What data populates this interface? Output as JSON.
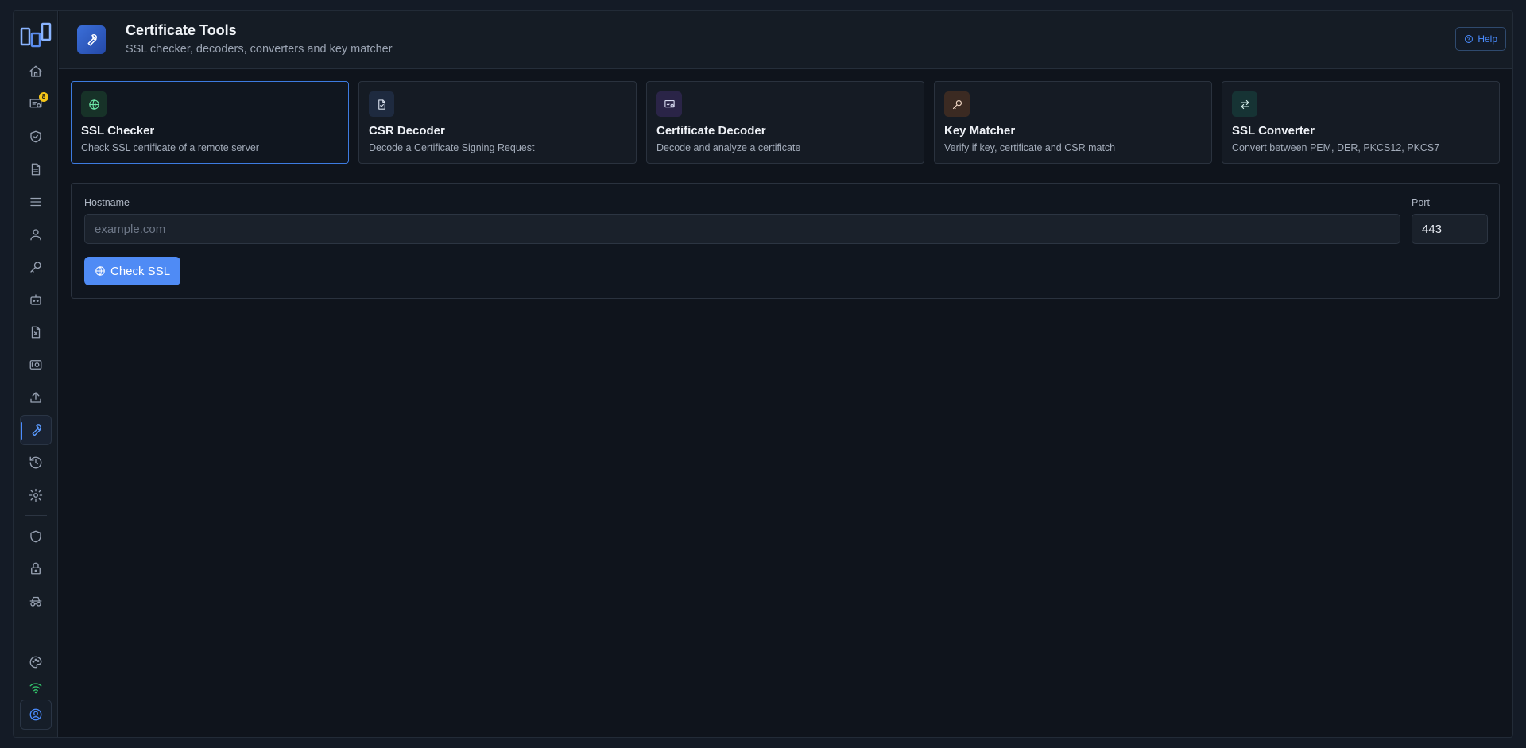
{
  "header": {
    "title": "Certificate Tools",
    "subtitle": "SSL checker, decoders, converters and key matcher",
    "help_label": "Help",
    "icon": "wrench-icon"
  },
  "sidebar": {
    "badge_count": "8",
    "accent_color": "#4a8cff",
    "items": [
      {
        "name": "home",
        "icon": "home-icon"
      },
      {
        "name": "certificates",
        "icon": "certificate-icon",
        "badge": "8"
      },
      {
        "name": "shield-check",
        "icon": "shield-check-icon"
      },
      {
        "name": "documents",
        "icon": "document-icon"
      },
      {
        "name": "list",
        "icon": "list-icon"
      },
      {
        "name": "users",
        "icon": "user-icon"
      },
      {
        "name": "keys",
        "icon": "key-icon"
      },
      {
        "name": "bots",
        "icon": "bot-icon"
      },
      {
        "name": "file-code",
        "icon": "file-x-icon"
      },
      {
        "name": "vault",
        "icon": "vault-icon"
      },
      {
        "name": "upload",
        "icon": "upload-icon"
      },
      {
        "name": "tools",
        "icon": "wrench-icon",
        "active": true
      },
      {
        "name": "history",
        "icon": "history-icon"
      },
      {
        "name": "settings",
        "icon": "gear-icon"
      },
      {
        "name": "shield",
        "icon": "shield-icon"
      },
      {
        "name": "lock",
        "icon": "lock-icon"
      },
      {
        "name": "incognito",
        "icon": "incognito-icon"
      },
      {
        "name": "theme",
        "icon": "palette-icon"
      },
      {
        "name": "connection",
        "icon": "wifi-icon"
      },
      {
        "name": "profile",
        "icon": "user-circle-icon"
      }
    ]
  },
  "tools": [
    {
      "title": "SSL Checker",
      "description": "Check SSL certificate of a remote server",
      "icon": "globe-icon",
      "active": true,
      "icon_bg": "#173228",
      "icon_color": "#6ee7a8"
    },
    {
      "title": "CSR Decoder",
      "description": "Decode a Certificate Signing Request",
      "icon": "file-icon",
      "icon_bg": "#1e2a3f",
      "icon_color": "#d9e1ee"
    },
    {
      "title": "Certificate Decoder",
      "description": "Decode and analyze a certificate",
      "icon": "certificate-icon",
      "icon_bg": "#2a2447",
      "icon_color": "#d9dcf2"
    },
    {
      "title": "Key Matcher",
      "description": "Verify if key, certificate and CSR match",
      "icon": "key-icon",
      "icon_bg": "#3b2a22",
      "icon_color": "#f0d6c4"
    },
    {
      "title": "SSL Converter",
      "description": "Convert between PEM, DER, PKCS12, PKCS7",
      "icon": "swap-arrows-icon",
      "icon_bg": "#163334",
      "icon_color": "#d8f0ee"
    }
  ],
  "form": {
    "hostname_label": "Hostname",
    "hostname_placeholder": "example.com",
    "hostname_value": "",
    "port_label": "Port",
    "port_value": "443",
    "submit_label": "Check SSL"
  }
}
